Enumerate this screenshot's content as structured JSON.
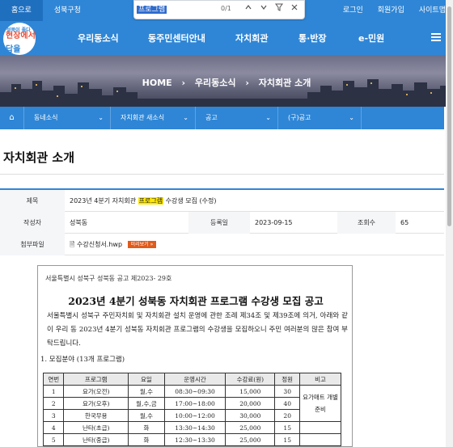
{
  "topbar": {
    "home_label": "홈으로",
    "district_label": "성북구청",
    "login": "로그인",
    "signup": "회원가입",
    "sitemap": "사이트맵"
  },
  "findbar": {
    "query": "프로그램",
    "counter": "0/1"
  },
  "logo": {
    "line1": "성북이 좋다",
    "line2": "현장에서 답을",
    "line3": "답을"
  },
  "nav": {
    "items": [
      "우리동소식",
      "동주민센터안내",
      "자치회관",
      "통·반장",
      "e-민원"
    ]
  },
  "hero": {
    "crumbs": [
      "HOME",
      "우리동소식",
      "자치회관 소개"
    ]
  },
  "dropbar": {
    "items": [
      "동네소식",
      "자치회관 새소식",
      "공고",
      "(구)공고"
    ]
  },
  "page": {
    "title": "자치회관 소개"
  },
  "info": {
    "label_title": "제목",
    "title_before": "2023년 4분기 자치회관 ",
    "title_highlight": "프로그램",
    "title_after": " 수강생 모집 (수정)",
    "label_author": "작성자",
    "author": "성북동",
    "label_date": "등록일",
    "date": "2023-09-15",
    "label_views": "조회수",
    "views": "65",
    "label_attach": "첨부파일",
    "attachment": "수강신청서.hwp",
    "preview_label": "미리보기"
  },
  "doc": {
    "notice_no": "서울특별시 성북구 성북동 공고 제2023- 29호",
    "title": "2023년 4분기 성북동 자치회관 프로그램 수강생 모집 공고",
    "paragraph": "서울특별시 성북구 주민자치회 및 자치회관 설치 운영에 관한 조례 제34조 및 제39조에 의거, 아래와 같이 우리 동 2023년 4분기 성북동 자치회관 프로그램의 수강생을 모집하오니 주민 여러분의 많은 참여 부탁드립니다.",
    "section": "1. 모집분야 (13개 프로그램)",
    "table": {
      "headers": [
        "연번",
        "프로그램",
        "요일",
        "운영시간",
        "수강료(원)",
        "정원",
        "비고"
      ],
      "rows": [
        [
          "1",
          "요가(오전)",
          "월,수",
          "08:30~09:30",
          "15,000",
          "30"
        ],
        [
          "2",
          "요가(오후)",
          "월,수,금",
          "17:00~18:00",
          "20,000",
          "40"
        ],
        [
          "3",
          "한국무용",
          "월,수",
          "10:00~12:00",
          "30,000",
          "20"
        ],
        [
          "4",
          "난타(초급)",
          "화",
          "13:30~14:30",
          "25,000",
          "15"
        ],
        [
          "5",
          "난타(중급)",
          "화",
          "12:30~13:30",
          "25,000",
          "15"
        ]
      ],
      "note": "요가매트 개별준비"
    }
  }
}
